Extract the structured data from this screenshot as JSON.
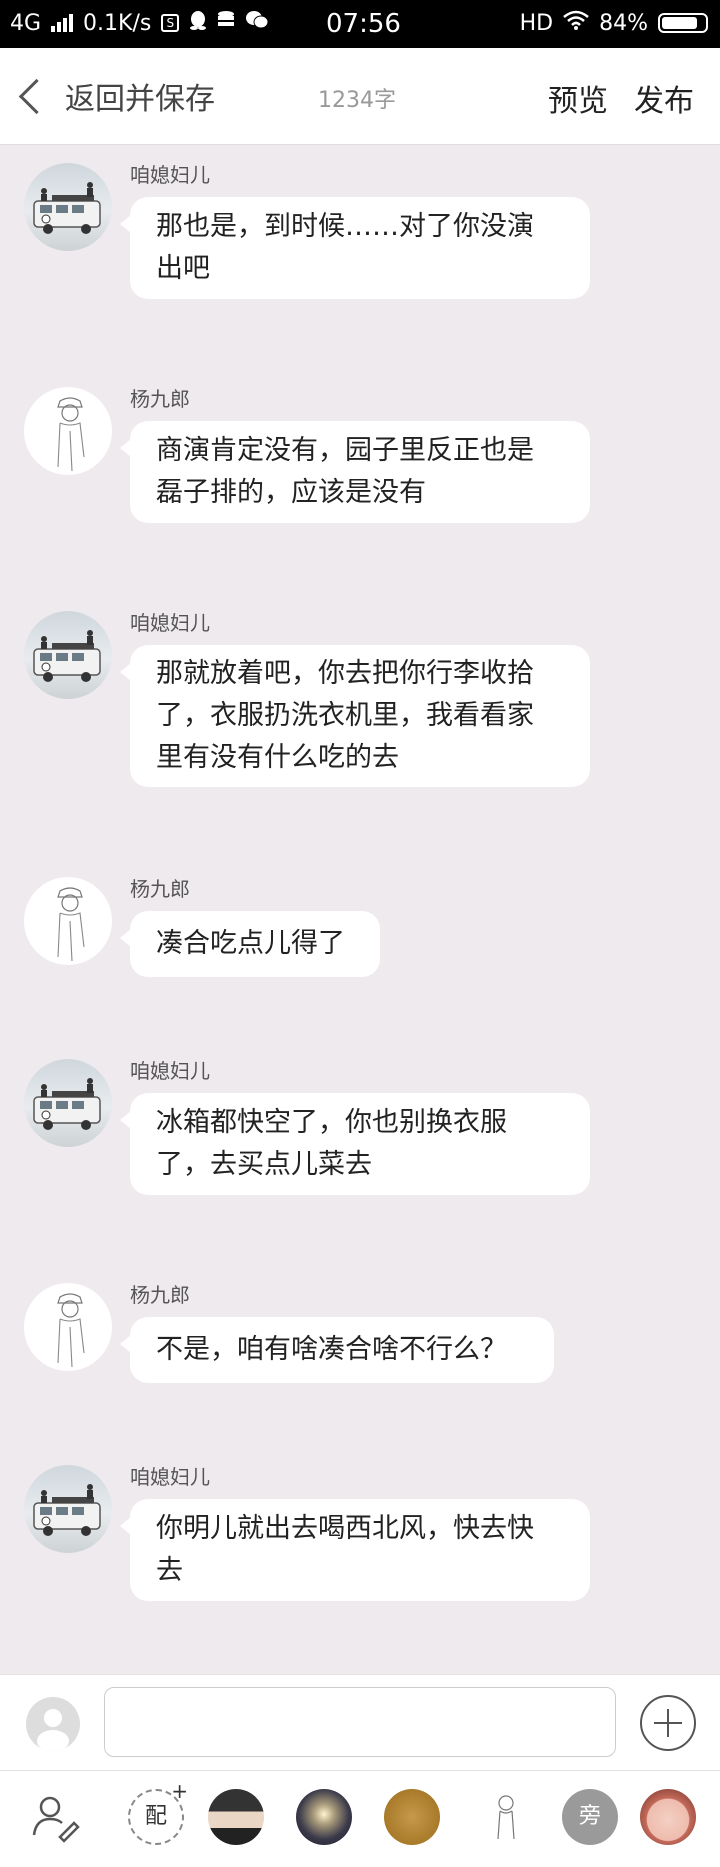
{
  "status_bar": {
    "network": "4G",
    "speed": "0.1K/s",
    "time": "07:56",
    "hd": "HD",
    "battery": "84%",
    "battery_level": 0.84
  },
  "header": {
    "back_label": "返回并保存",
    "word_count": "1234字",
    "preview_label": "预览",
    "publish_label": "发布"
  },
  "messages": [
    {
      "sender": "咱媳妇儿",
      "avatar": "van-avatar",
      "lines": [
        "那也是，到时候……对了你没演",
        "出吧"
      ]
    },
    {
      "sender": "杨九郎",
      "avatar": "sketch-avatar",
      "lines": [
        "商演肯定没有，园子里反正也是",
        "磊子排的，应该是没有"
      ]
    },
    {
      "sender": "咱媳妇儿",
      "avatar": "van-avatar",
      "lines": [
        "那就放着吧，你去把你行李收拾",
        "了，衣服扔洗衣机里，我看看家",
        "里有没有什么吃的去"
      ]
    },
    {
      "sender": "杨九郎",
      "avatar": "sketch-avatar",
      "lines": [
        "凑合吃点儿得了"
      ]
    },
    {
      "sender": "咱媳妇儿",
      "avatar": "van-avatar",
      "lines": [
        "冰箱都快空了，你也别换衣服",
        "了，去买点儿菜去"
      ]
    },
    {
      "sender": "杨九郎",
      "avatar": "sketch-avatar",
      "lines": [
        "不是，咱有啥凑合啥不行么？"
      ]
    },
    {
      "sender": "咱媳妇儿",
      "avatar": "van-avatar",
      "lines": [
        "你明儿就出去喝西北风，快去快",
        "去"
      ]
    }
  ],
  "input": {
    "placeholder": ""
  },
  "bottom_bar": {
    "pei_label": "配",
    "pang_label": "旁",
    "icons": [
      "edit-user-icon",
      "pei-button",
      "character-avatar-1",
      "character-avatar-2",
      "character-avatar-3",
      "character-avatar-4",
      "narration-button",
      "character-avatar-5"
    ]
  }
}
